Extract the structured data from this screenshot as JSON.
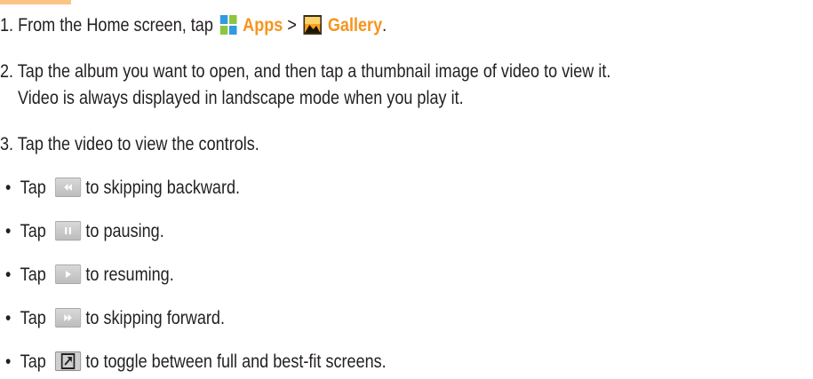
{
  "steps": {
    "s1": {
      "prefix": "1. From the Home screen, tap",
      "apps": "Apps",
      "gt": ">",
      "gallery": "Gallery",
      "end": "."
    },
    "s2": {
      "line1": "2. Tap the album you want to open, and then tap a thumbnail image of video to view it.",
      "line2": "Video is always displayed in landscape mode when you play it."
    },
    "s3": "3. Tap the video to view the controls."
  },
  "bullets": [
    {
      "tap": "Tap",
      "text": "to skipping backward.",
      "icon": "rewind-icon"
    },
    {
      "tap": "Tap",
      "text": "to pausing.",
      "icon": "pause-icon"
    },
    {
      "tap": "Tap",
      "text": "to resuming.",
      "icon": "play-icon"
    },
    {
      "tap": "Tap",
      "text": "to skipping forward.",
      "icon": "fast-forward-icon"
    },
    {
      "tap": "Tap",
      "text": "to toggle between full and best-fit screens.",
      "icon": "fit-screen-icon"
    }
  ],
  "colors": {
    "accent": "#f7941d",
    "text": "#231f20"
  }
}
